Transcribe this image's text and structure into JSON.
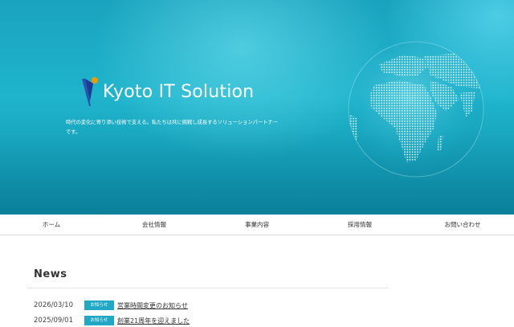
{
  "hero": {
    "brand": "Kyoto IT Solution",
    "tagline": "時代の変化に寄り添い技術で支える。私たちは共に挑戦し成長するソリューションパートナーです。"
  },
  "nav": {
    "items": [
      {
        "label": "ホーム"
      },
      {
        "label": "会社情報"
      },
      {
        "label": "事業内容"
      },
      {
        "label": "採用情報"
      },
      {
        "label": "お問い合わせ"
      }
    ]
  },
  "news": {
    "heading": "News",
    "items": [
      {
        "date": "2026/03/10",
        "badge": "お知らせ",
        "title": "営業時間変更のお知らせ"
      },
      {
        "date": "2025/09/01",
        "badge": "お知らせ",
        "title": "創業21周年を迎えました"
      }
    ]
  },
  "colors": {
    "hero_teal": "#1fb4cc",
    "accent_badge": "#20a8c4",
    "logo_blue": "#1a3d8f",
    "logo_orange": "#f39800"
  },
  "icons": {
    "logo": "kyoto-it-logo-mark",
    "globe": "globe-dotted-world-map"
  }
}
